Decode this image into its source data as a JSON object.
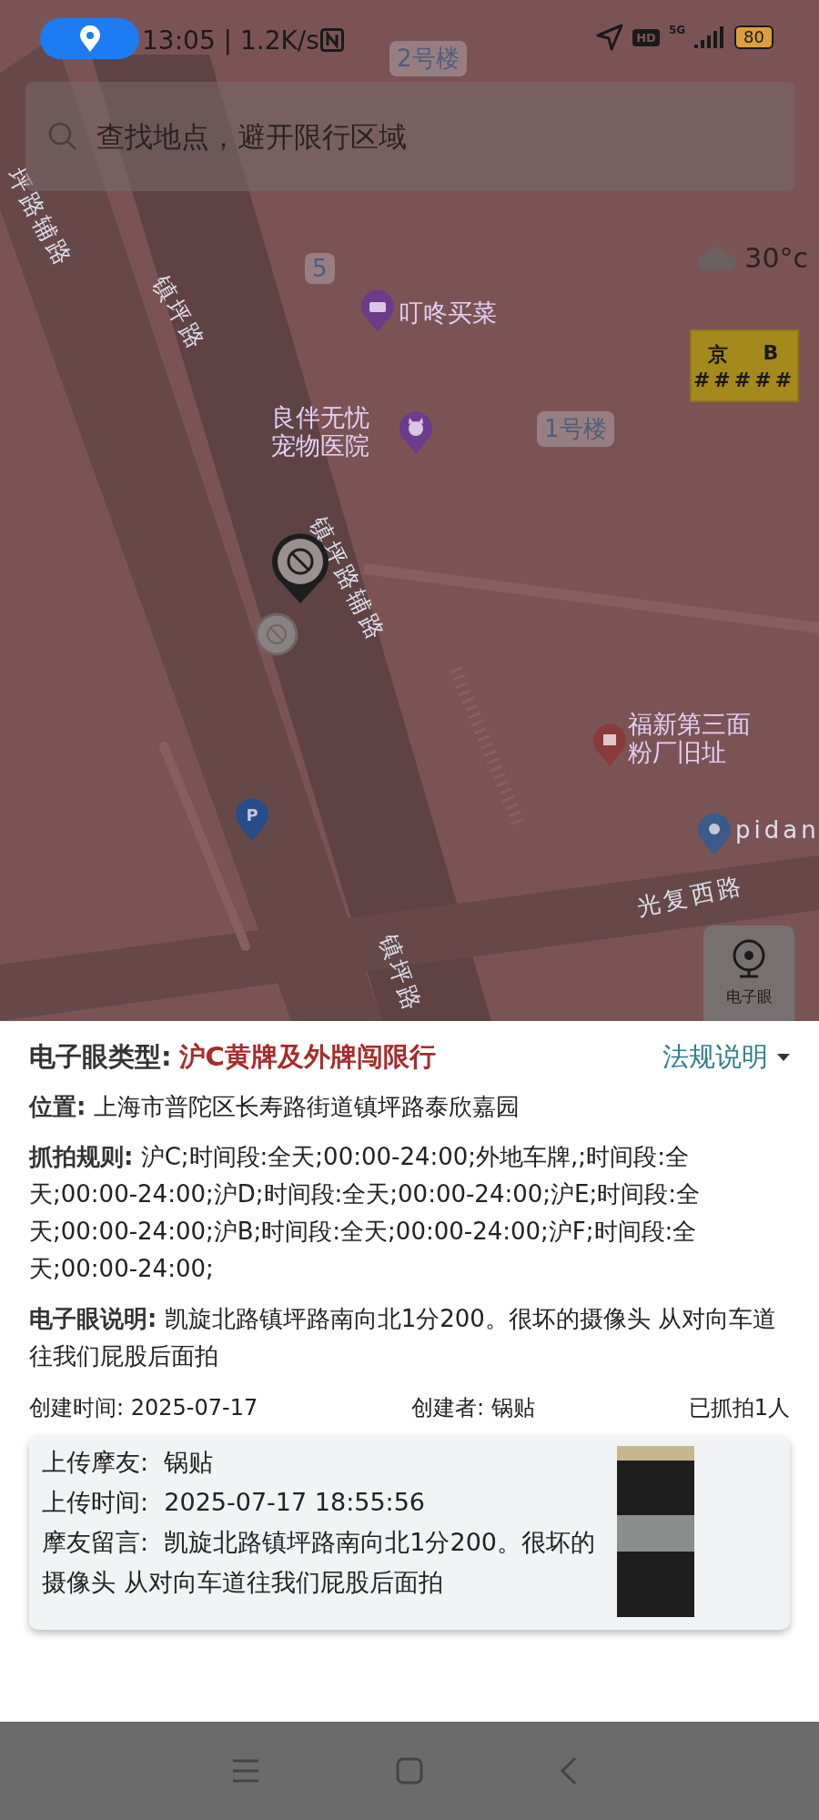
{
  "status_bar": {
    "time": "13:05 | 1.2K/s",
    "hd": "HD",
    "network": "5G",
    "battery": "80"
  },
  "search": {
    "placeholder": "查找地点，避开限行区域"
  },
  "weather": {
    "temperature": "30°c"
  },
  "map": {
    "labels": [
      {
        "kind": "badge",
        "text": "2号楼"
      },
      {
        "kind": "badge",
        "text": "5"
      },
      {
        "kind": "poi",
        "text": "叮咚买菜"
      },
      {
        "kind": "poi",
        "text": "良伴无忧宠物医院"
      },
      {
        "kind": "badge",
        "text": "1号楼"
      },
      {
        "kind": "road",
        "text": "坪路辅路"
      },
      {
        "kind": "road",
        "text": "镇坪路"
      },
      {
        "kind": "road",
        "text": "镇坪路辅路"
      },
      {
        "kind": "poi",
        "text": "福新第三面粉厂旧址"
      },
      {
        "kind": "road",
        "text": "pidan"
      },
      {
        "kind": "road",
        "text": "光复西路"
      },
      {
        "kind": "road",
        "text": "镇坪路"
      }
    ]
  },
  "parking": {
    "label": "P"
  },
  "plate": {
    "province": "京",
    "letter": "B",
    "number": "#####"
  },
  "camera_button": {
    "label": "电子眼"
  },
  "detail": {
    "type_label": "电子眼类型:",
    "type_value": "沪C黄牌及外牌闯限行",
    "regulation_link": "法规说明",
    "location": "**位置:** 上海市普陀区长寿路街道镇坪路泰欣嘉园",
    "rules": "**抓拍规则:** 沪C;时间段:全天;00:00-24:00;外地车牌,;时间段:全天;00:00-24:00;沪D;时间段:全天;00:00-24:00;沪E;时间段:全天;00:00-24:00;沪B;时间段:全天;00:00-24:00;沪F;时间段:全天;00:00-24:00;",
    "description": "**电子眼说明:** 凯旋北路镇坪路南向北1分200。很坏的摄像头 从对向车道往我们屁股后面拍"
  },
  "meta": {
    "created": "创建时间: 2025-07-17",
    "creator": "创建者: 锅贴",
    "captured": "已抓拍1人"
  },
  "upload": {
    "rows": [
      {
        "label": "上传摩友:",
        "value": "锅贴"
      },
      {
        "label": "上传时间:",
        "value": "2025-07-17 18:55:56"
      },
      {
        "label": "摩友留言:",
        "value": "凯旋北路镇坪路南向北1分200。很坏的摄像头 从对向车道往我们屁股后面拍"
      }
    ]
  }
}
